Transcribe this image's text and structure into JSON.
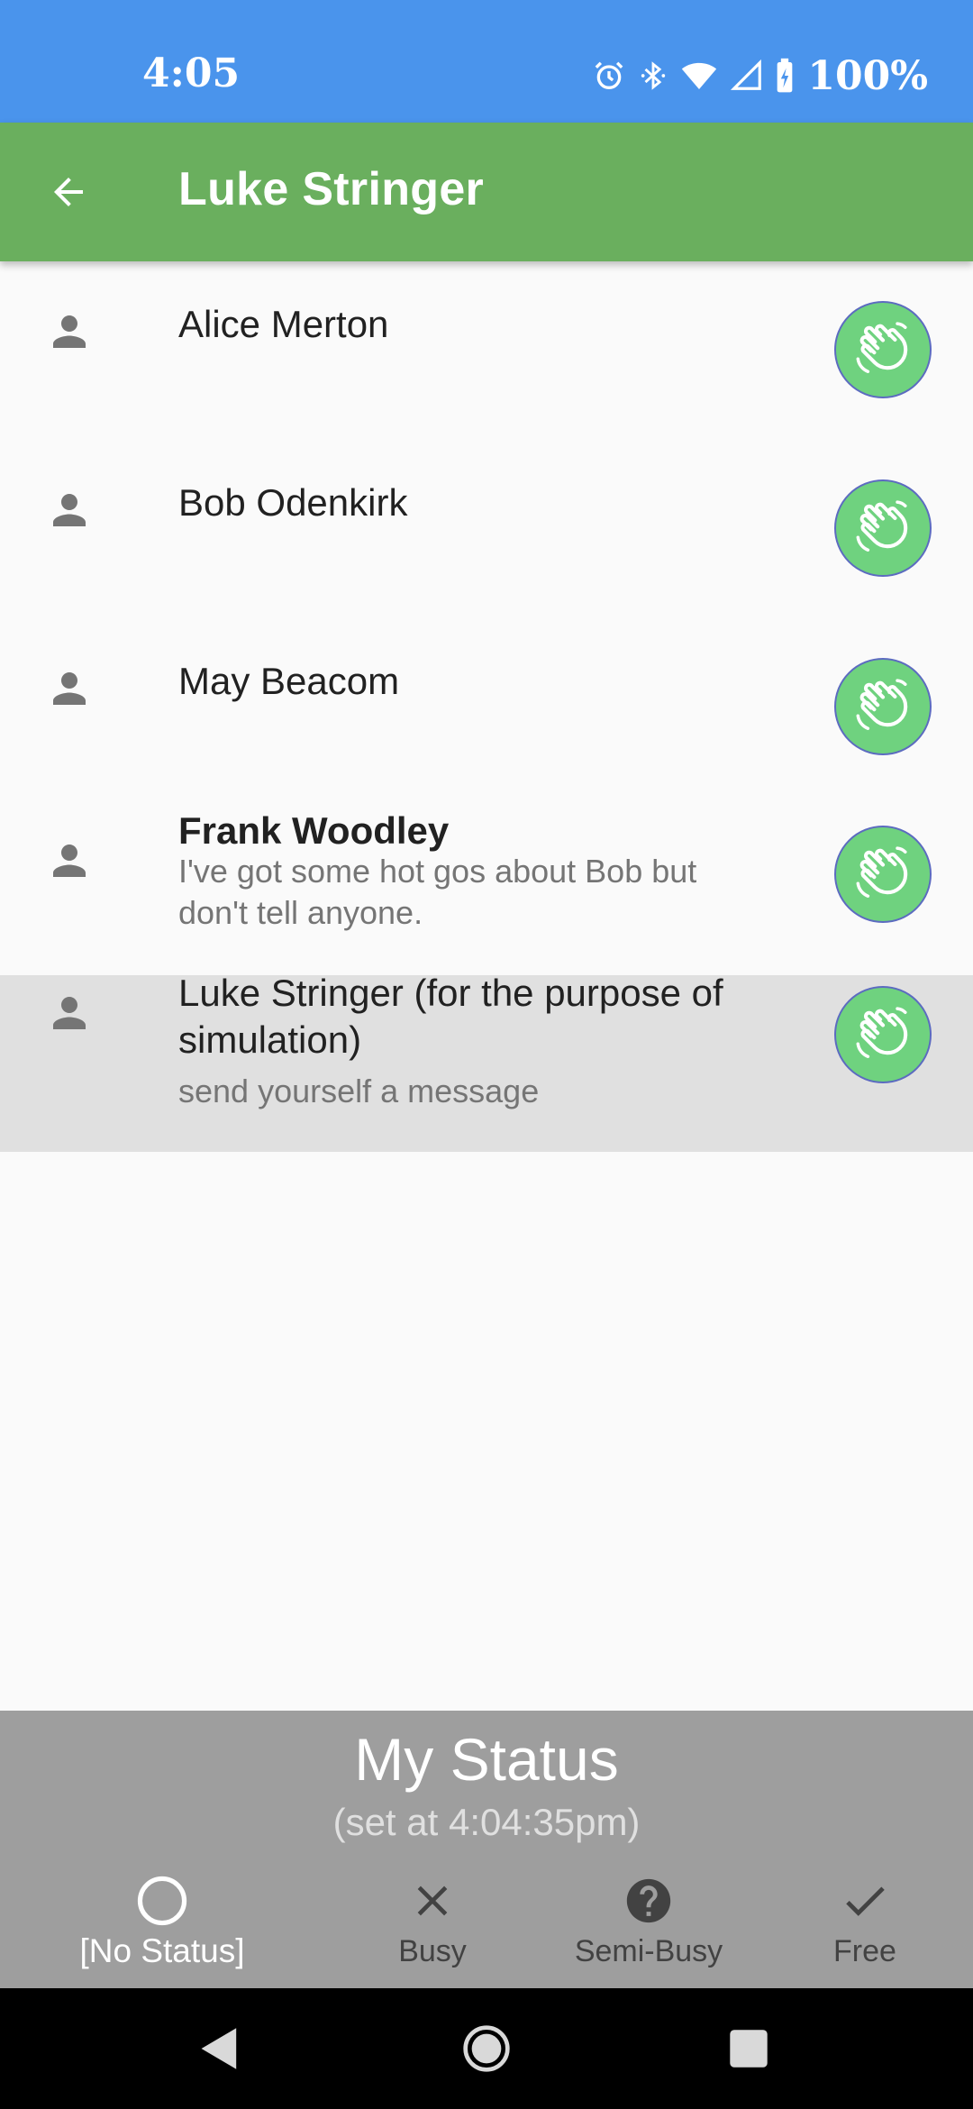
{
  "status_bar": {
    "time": "4:05",
    "battery": "100%",
    "icons": [
      "alarm-icon",
      "bluetooth-icon",
      "wifi-icon",
      "signal-icon",
      "battery-icon"
    ]
  },
  "app_bar": {
    "title": "Luke Stringer",
    "back_icon": "arrow-back-icon"
  },
  "contacts": [
    {
      "name": "Alice Merton",
      "message": "",
      "bold": false,
      "selected": false,
      "action_icon": "wave-hand-icon"
    },
    {
      "name": "Bob Odenkirk",
      "message": "",
      "bold": false,
      "selected": false,
      "action_icon": "wave-hand-icon"
    },
    {
      "name": "May Beacom",
      "message": "",
      "bold": false,
      "selected": false,
      "action_icon": "wave-hand-icon"
    },
    {
      "name": "Frank Woodley",
      "message": "I've got some hot gos about Bob but don't tell anyone.",
      "bold": true,
      "selected": false,
      "action_icon": "wave-hand-icon"
    },
    {
      "name": "Luke Stringer (for the purpose of simulation)",
      "message": "send yourself a message",
      "bold": false,
      "selected": true,
      "action_icon": "wave-hand-icon"
    }
  ],
  "my_status": {
    "title": "My Status",
    "subtitle": "(set at 4:04:35pm)"
  },
  "status_options": [
    {
      "label": "[No Status]",
      "icon": "circle-outline-icon",
      "active": true
    },
    {
      "label": "Busy",
      "icon": "close-icon",
      "active": false
    },
    {
      "label": "Semi-Busy",
      "icon": "help-circle-icon",
      "active": false
    },
    {
      "label": "Free",
      "icon": "check-icon",
      "active": false
    }
  ],
  "colors": {
    "status_bar": "#4A94EC",
    "app_bar": "#6AAF5E",
    "wave_button": "#6FD27F",
    "status_panel": "#9E9E9E",
    "selected_row": "#E0E0E0"
  }
}
